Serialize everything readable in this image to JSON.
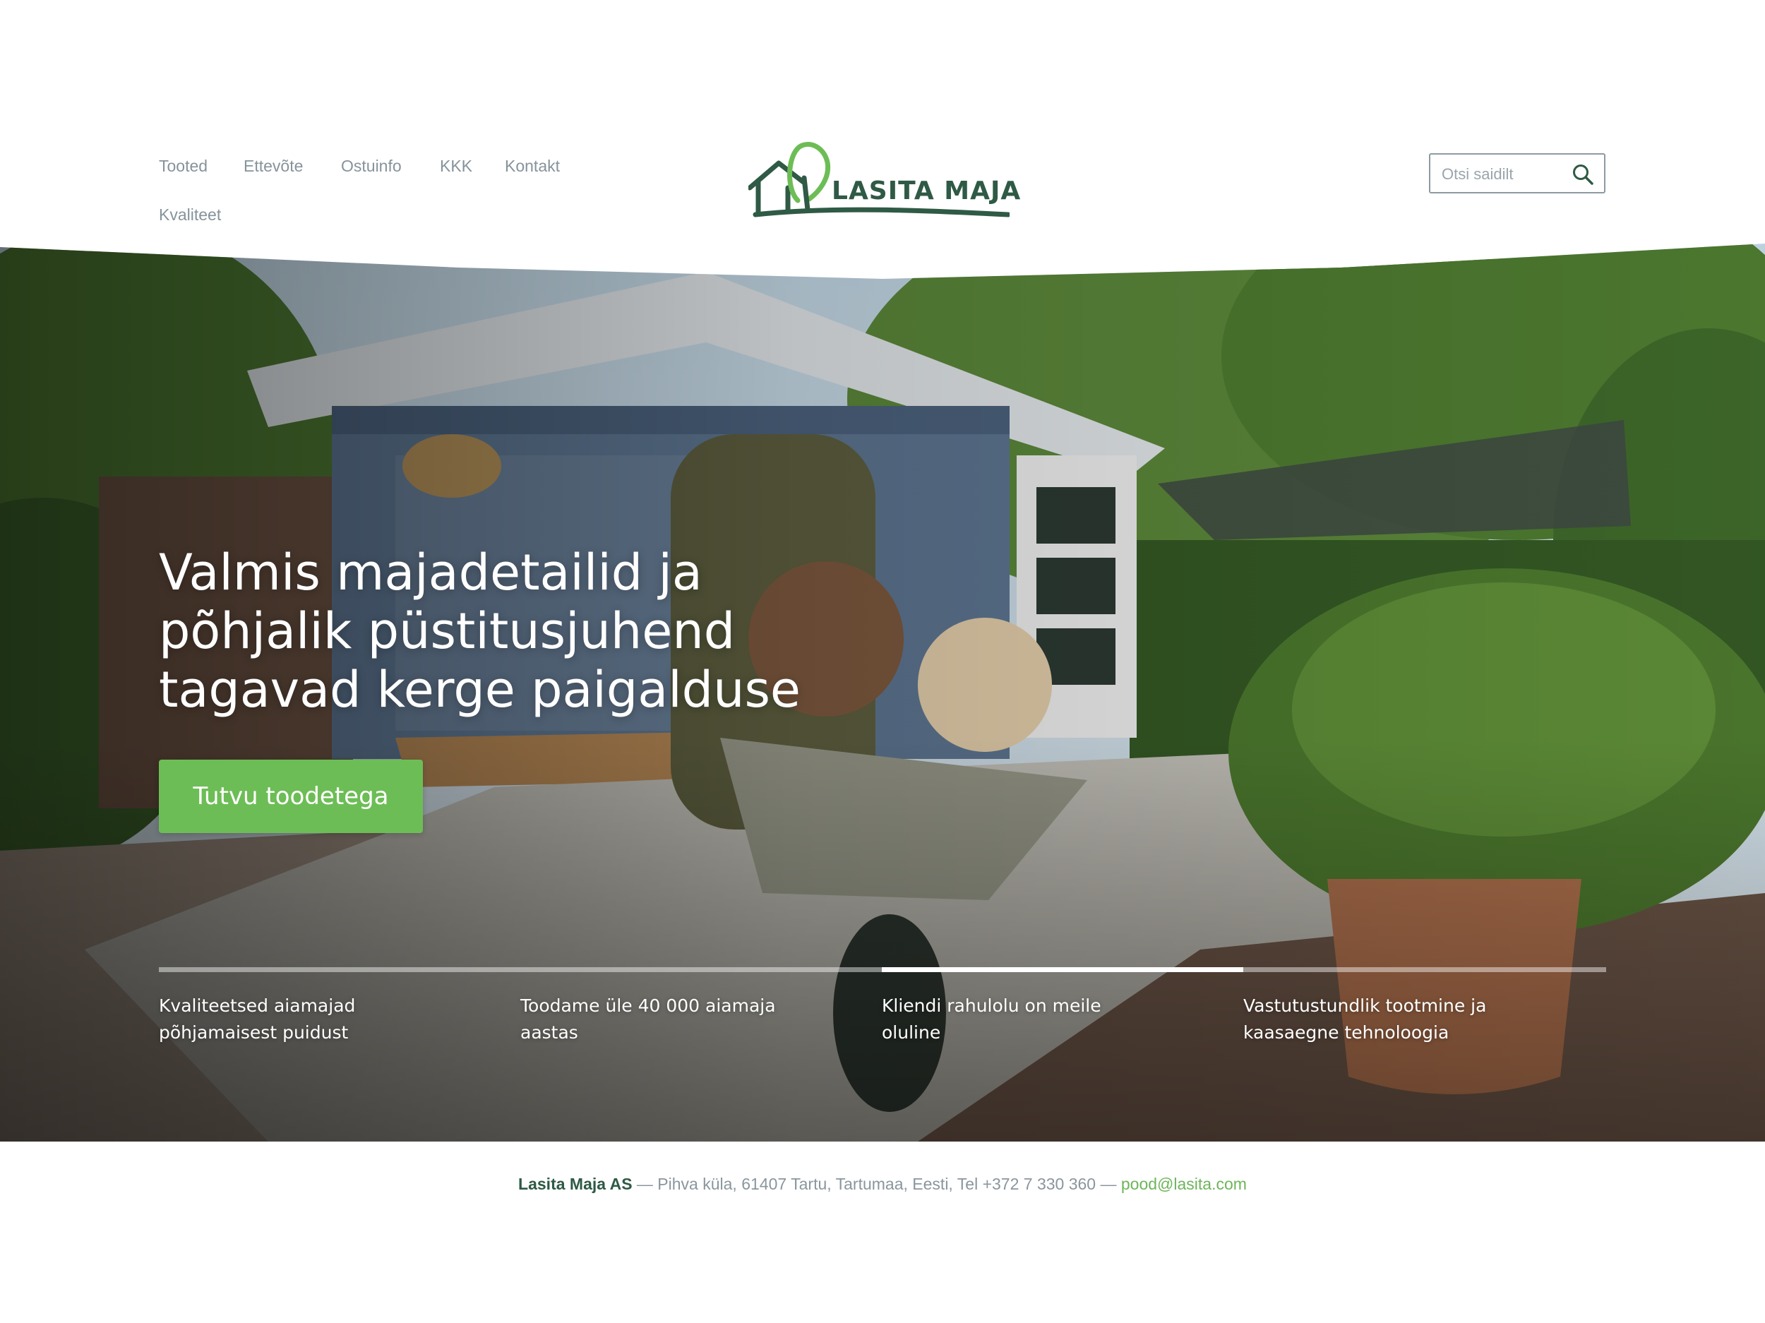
{
  "nav": {
    "items": [
      {
        "label": "Tooted"
      },
      {
        "label": "Ettevõte"
      },
      {
        "label": "Ostuinfo"
      },
      {
        "label": "KKK"
      },
      {
        "label": "Kontakt"
      },
      {
        "label": "Kvaliteet"
      }
    ]
  },
  "logo": {
    "text": "LASITA MAJA",
    "color": "#2f5a45",
    "accent": "#6dbd56",
    "icon": "house-tree-icon"
  },
  "search": {
    "placeholder": "Otsi saidilt",
    "value": "",
    "icon": "search-icon"
  },
  "hero": {
    "title_lines": [
      "Valmis majadetailid ja",
      "põhjalik püstitusjuhend",
      "tagavad kerge paigalduse"
    ],
    "cta_label": "Tutvu toodetega",
    "cta_color": "#6dbd56"
  },
  "features": [
    {
      "lines": [
        "Kvaliteetsed aiamajad",
        "põhjamaisest puidust"
      ],
      "active": false
    },
    {
      "lines": [
        "Toodame üle 40 000 aiamaja",
        "aastas"
      ],
      "active": false
    },
    {
      "lines": [
        "Kliendi rahulolu on meile",
        "oluline"
      ],
      "active": true
    },
    {
      "lines": [
        "Vastutustundlik tootmine ja",
        "kaasaegne tehnoloogia"
      ],
      "active": false
    }
  ],
  "footer": {
    "company": "Lasita Maja AS",
    "address": " — Pihva küla, 61407 Tartu, Tartumaa, Eesti, Tel +372 7 330 360 — ",
    "email": "pood@lasita.com"
  }
}
